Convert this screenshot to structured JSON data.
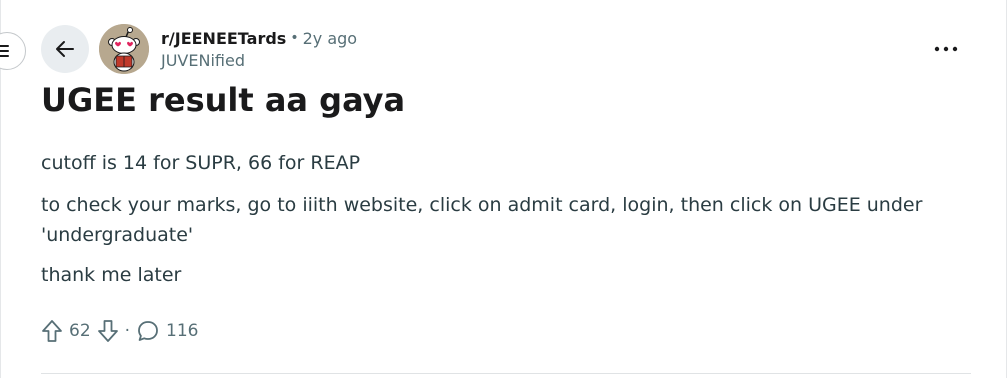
{
  "post": {
    "subreddit": "r/JEENEETards",
    "separator": "•",
    "time_ago": "2y ago",
    "author": "JUVENified",
    "title": "UGEE result aa gaya",
    "body": [
      "cutoff is 14 for SUPR, 66 for REAP",
      "to check your marks, go to iiith website, click on admit card, login, then click on UGEE under 'undergraduate'",
      "thank me later"
    ]
  },
  "actions": {
    "upvotes": "62",
    "separator": "·",
    "comments": "116"
  },
  "icons": {
    "menu": "hamburger-menu-icon",
    "back": "arrow-left-icon",
    "overflow": "more-horizontal-icon",
    "upvote": "arrow-up-outline-icon",
    "downvote": "arrow-down-outline-icon",
    "comment": "speech-bubble-icon"
  },
  "colors": {
    "meta_text": "#576f76",
    "body_text": "#2a3c42",
    "back_button_bg": "#e9edf0"
  }
}
